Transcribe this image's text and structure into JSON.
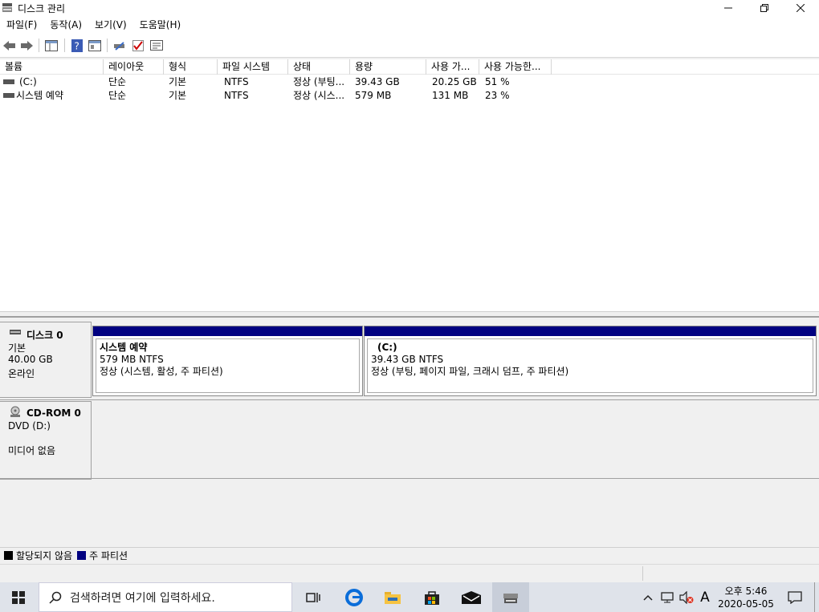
{
  "window": {
    "title": "디스크 관리"
  },
  "menu": [
    "파일(F)",
    "동작(A)",
    "보기(V)",
    "도움말(H)"
  ],
  "columns": [
    "볼륨",
    "레이아웃",
    "형식",
    "파일 시스템",
    "상태",
    "용량",
    "사용 가...",
    "사용 가능한..."
  ],
  "volumes": [
    {
      "name": "(C:)",
      "layout": "단순",
      "type": "기본",
      "fs": "NTFS",
      "status": "정상 (부팅...",
      "capacity": "39.43 GB",
      "free": "20.25 GB",
      "pct": "51 %"
    },
    {
      "name": "시스템 예약",
      "layout": "단순",
      "type": "기본",
      "fs": "NTFS",
      "status": "정상 (시스...",
      "capacity": "579 MB",
      "free": "131 MB",
      "pct": "23 %"
    }
  ],
  "disks": [
    {
      "name": "디스크 0",
      "type": "기본",
      "size": "40.00 GB",
      "state": "온라인",
      "partitions": [
        {
          "name": "시스템 예약",
          "size": "579 MB NTFS",
          "status": "정상 (시스템, 활성, 주 파티션)"
        },
        {
          "name": "(C:)",
          "size": "39.43 GB NTFS",
          "status": "정상 (부팅, 페이지 파일, 크래시 덤프, 주 파티션)"
        }
      ]
    },
    {
      "name": "CD-ROM 0",
      "type": "DVD (D:)",
      "size": "",
      "state": "미디어 없음"
    }
  ],
  "legend": [
    {
      "label": "할당되지 않음",
      "color": "#000000"
    },
    {
      "label": "주 파티션",
      "color": "#000080"
    }
  ],
  "taskbar": {
    "search_placeholder": "검색하려면 여기에 입력하세요.",
    "ime": "A",
    "time": "오후 5:46",
    "date": "2020-05-05"
  },
  "icons": [
    "windows-start-icon",
    "search-icon",
    "task-view-icon",
    "edge-icon",
    "file-explorer-icon",
    "store-icon",
    "mail-icon",
    "disk-management-icon",
    "chevron-up-icon",
    "network-icon",
    "volume-muted-icon",
    "notification-icon"
  ]
}
